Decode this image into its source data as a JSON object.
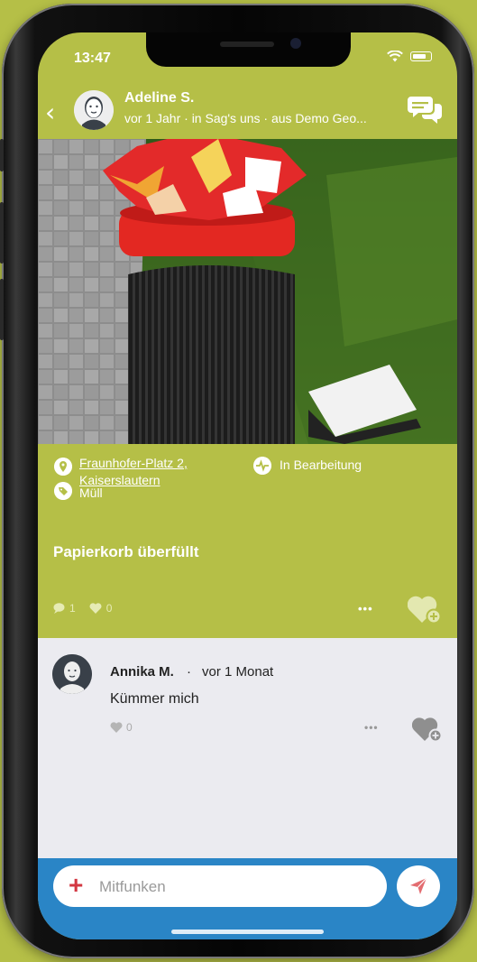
{
  "status_bar": {
    "time": "13:47"
  },
  "post": {
    "author": "Adeline S.",
    "meta": "vor 1 Jahr · in Sag's uns · aus Demo Geo...",
    "address_line1": "Fraunhofer-Platz 2,",
    "address_line2": "Kaiserslautern",
    "status": "In Bearbeitung",
    "category": "Müll",
    "title": "Papierkorb überfüllt",
    "comment_count": "1",
    "like_count": "0",
    "more_label": "•••"
  },
  "comment": {
    "author": "Annika M.",
    "separator": "·",
    "time": "vor 1 Monat",
    "text": "Kümmer mich",
    "like_count": "0",
    "more_label": "•••"
  },
  "composer": {
    "placeholder": "Mitfunken",
    "plus_label": "+"
  },
  "icons": [
    "back-chevron-icon",
    "chat-bubbles-icon",
    "location-pin-icon",
    "pulse-icon",
    "tag-icon",
    "comment-icon",
    "heart-icon",
    "heart-plus-icon",
    "send-icon",
    "wifi-icon",
    "battery-icon"
  ],
  "colors": {
    "brand_green": "#b5bf47",
    "composer_blue": "#2a85c6",
    "accent_red": "#d33842",
    "comment_bg": "#ebebf0"
  }
}
